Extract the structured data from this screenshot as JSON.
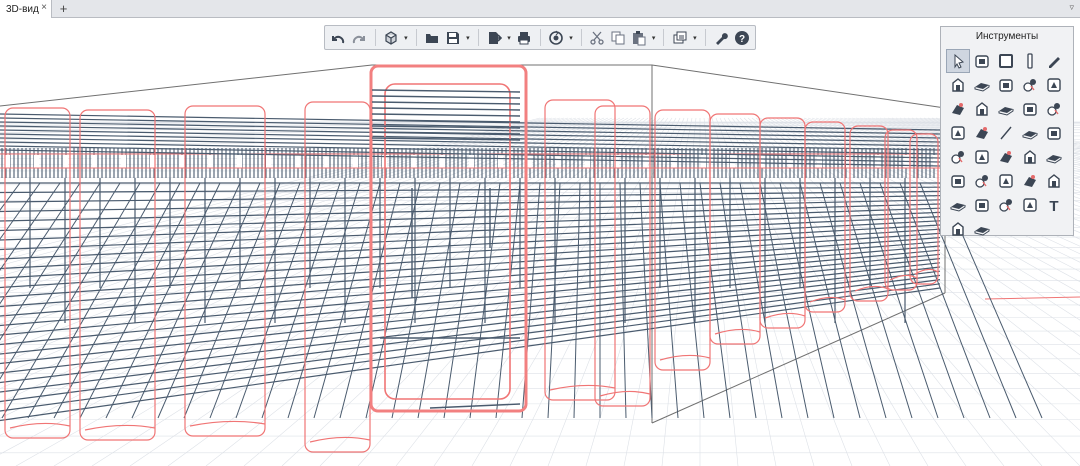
{
  "tabs": [
    {
      "label": "3D-вид",
      "close": "×"
    }
  ],
  "tab_add": "+",
  "tab_menu": "▿",
  "toolbar": {
    "buttons": [
      {
        "name": "undo-icon"
      },
      {
        "name": "redo-icon"
      },
      {
        "name": "view-cube-icon",
        "dropdown": true
      },
      {
        "name": "open-folder-icon"
      },
      {
        "name": "save-icon",
        "dropdown": true
      },
      {
        "name": "export-icon",
        "dropdown": true
      },
      {
        "name": "print-icon"
      },
      {
        "name": "orbit-icon",
        "dropdown": true
      },
      {
        "name": "cut-icon"
      },
      {
        "name": "copy-icon"
      },
      {
        "name": "paste-icon",
        "dropdown": true
      },
      {
        "name": "layers-icon",
        "dropdown": true
      },
      {
        "name": "settings-wrench-icon"
      },
      {
        "name": "help-icon"
      }
    ],
    "dropdown_glyph": "▾"
  },
  "palette": {
    "title": "Инструменты",
    "text_tool_label": "T",
    "tools": [
      "select-cursor-icon",
      "line-node-icon",
      "rect-plate-icon",
      "column-icon",
      "pencil-icon",
      "slab-icon",
      "slab-opening-icon",
      "beam-slab-icon",
      "roof-icon",
      "wall-icon",
      "cross-section-icon",
      "section-frame-icon",
      "table-icon",
      "stair-icon",
      "polygon-icon",
      "rebar-bend-icon",
      "bucket-icon",
      "line-icon",
      "stirrup-icon",
      "rebar-hook-icon",
      "mesh-tool-icon",
      "anchor-icon",
      "rebar-clamp-icon",
      "rebar-a-icon",
      "rebar-b-icon",
      "mesh-icon",
      "rebar-c-icon",
      "rebar-d-icon",
      "rebar-e-icon",
      "rebar-f-icon",
      "home-icon",
      "frame-icon",
      "detail-icon",
      "measure-icon",
      "text-icon",
      "dimension-icon",
      "pattern-icon"
    ]
  },
  "colors": {
    "rebar": "#4a5b6e",
    "stirrup": "#f07575",
    "highlight": "#f28080",
    "grid": "#dde1e7",
    "box": "#707070"
  }
}
